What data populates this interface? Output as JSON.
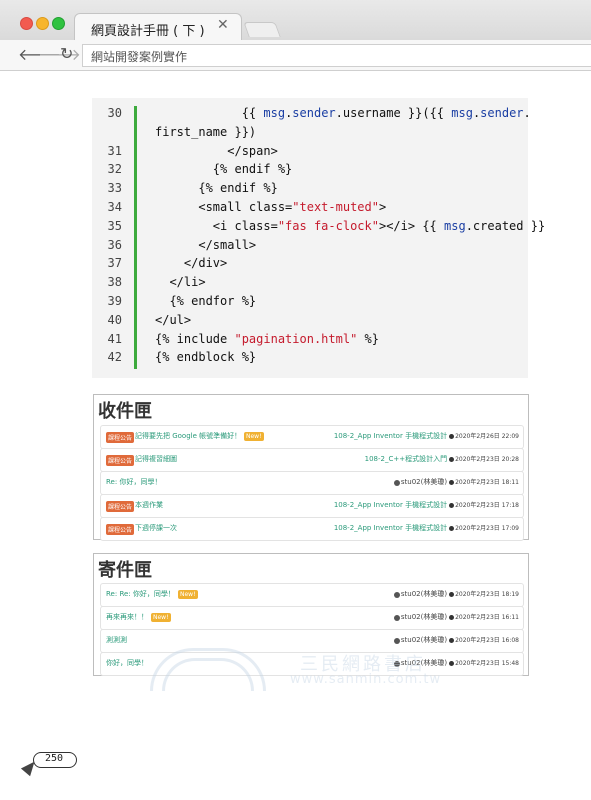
{
  "browser": {
    "tab_title": "網頁設計手冊 ( 下 )",
    "close_glyph": "✕",
    "back_glyph": "🡐",
    "forward_glyph": "🡒",
    "reload_glyph": "↻",
    "address": "網站開發案例實作"
  },
  "code": {
    "lines": [
      {
        "no": "30",
        "parts": [
          [
            "            {{ ",
            ""
          ],
          [
            "msg",
            "blue"
          ],
          [
            ".",
            ""
          ],
          [
            "sender",
            "blue"
          ],
          [
            ".username }}({{ ",
            ""
          ],
          [
            "msg",
            "blue"
          ],
          [
            ".",
            ""
          ],
          [
            "sender",
            "blue"
          ],
          [
            ".",
            ""
          ]
        ]
      },
      {
        "no": "",
        "parts": [
          [
            "first_name }})",
            ""
          ]
        ]
      },
      {
        "no": "31",
        "parts": [
          [
            "          </span>",
            ""
          ]
        ]
      },
      {
        "no": "32",
        "parts": [
          [
            "        {% endif %}",
            ""
          ]
        ]
      },
      {
        "no": "33",
        "parts": [
          [
            "      {% endif %}",
            ""
          ]
        ]
      },
      {
        "no": "34",
        "parts": [
          [
            "      <small class=",
            ""
          ],
          [
            "\"text-muted\"",
            "red"
          ],
          [
            ">",
            ""
          ]
        ]
      },
      {
        "no": "35",
        "parts": [
          [
            "        <i class=",
            ""
          ],
          [
            "\"fas fa-clock\"",
            "red"
          ],
          [
            "></i> {{ ",
            ""
          ],
          [
            "msg",
            "blue"
          ],
          [
            ".created }}",
            ""
          ]
        ]
      },
      {
        "no": "36",
        "parts": [
          [
            "      </small>",
            ""
          ]
        ]
      },
      {
        "no": "37",
        "parts": [
          [
            "    </div>",
            ""
          ]
        ]
      },
      {
        "no": "38",
        "parts": [
          [
            "  </li>",
            ""
          ]
        ]
      },
      {
        "no": "39",
        "parts": [
          [
            "  {% endfor %}",
            ""
          ]
        ]
      },
      {
        "no": "40",
        "parts": [
          [
            "</ul>",
            ""
          ]
        ]
      },
      {
        "no": "41",
        "parts": [
          [
            "{% include ",
            ""
          ],
          [
            "\"pagination.html\"",
            "red"
          ],
          [
            " %}",
            ""
          ]
        ]
      },
      {
        "no": "42",
        "parts": [
          [
            "{% endblock %}",
            ""
          ]
        ]
      }
    ]
  },
  "inbox": {
    "title": "收件匣",
    "rows": [
      {
        "category": "課程公告",
        "subject": "記得要先把 Google 帳號準備好！",
        "new": "New!",
        "sender": "108-2_App Inventor 手機程式設計",
        "sender_plain": false,
        "time": "2020年2月26日 22:09"
      },
      {
        "category": "課程公告",
        "subject": "記得複習細圖",
        "new": "",
        "sender": "108-2_C++程式設計入門",
        "sender_plain": false,
        "time": "2020年2月23日 20:28"
      },
      {
        "category": "",
        "subject": "Re: 你好，同學！",
        "new": "",
        "sender": "stu02(林美瓊)",
        "sender_plain": true,
        "time": "2020年2月23日 18:11"
      },
      {
        "category": "課程公告",
        "subject": "本週作業",
        "new": "",
        "sender": "108-2_App Inventor 手機程式設計",
        "sender_plain": false,
        "time": "2020年2月23日 17:18"
      },
      {
        "category": "課程公告",
        "subject": "下週停課一次",
        "new": "",
        "sender": "108-2_App Inventor 手機程式設計",
        "sender_plain": false,
        "time": "2020年2月23日 17:09"
      }
    ]
  },
  "sent": {
    "title": "寄件匣",
    "rows": [
      {
        "category": "",
        "subject": "Re: Re: 你好，同學！",
        "new": "New!",
        "sender": "stu02(林美瓊)",
        "sender_plain": true,
        "time": "2020年2月23日 18:19"
      },
      {
        "category": "",
        "subject": "再來再來！！",
        "new": "New!",
        "sender": "stu02(林美瓊)",
        "sender_plain": true,
        "time": "2020年2月23日 16:11"
      },
      {
        "category": "",
        "subject": "測測測",
        "new": "",
        "sender": "stu02(林美瓊)",
        "sender_plain": true,
        "time": "2020年2月23日 16:08"
      },
      {
        "category": "",
        "subject": "你好，同學！",
        "new": "",
        "sender": "stu02(林美瓊)",
        "sender_plain": true,
        "time": "2020年2月23日 15:48"
      }
    ]
  },
  "watermark": {
    "name": "三民網路書店",
    "url": "www.sanmin.com.tw",
    "logo_letters": "三 民"
  },
  "page_number": "250"
}
